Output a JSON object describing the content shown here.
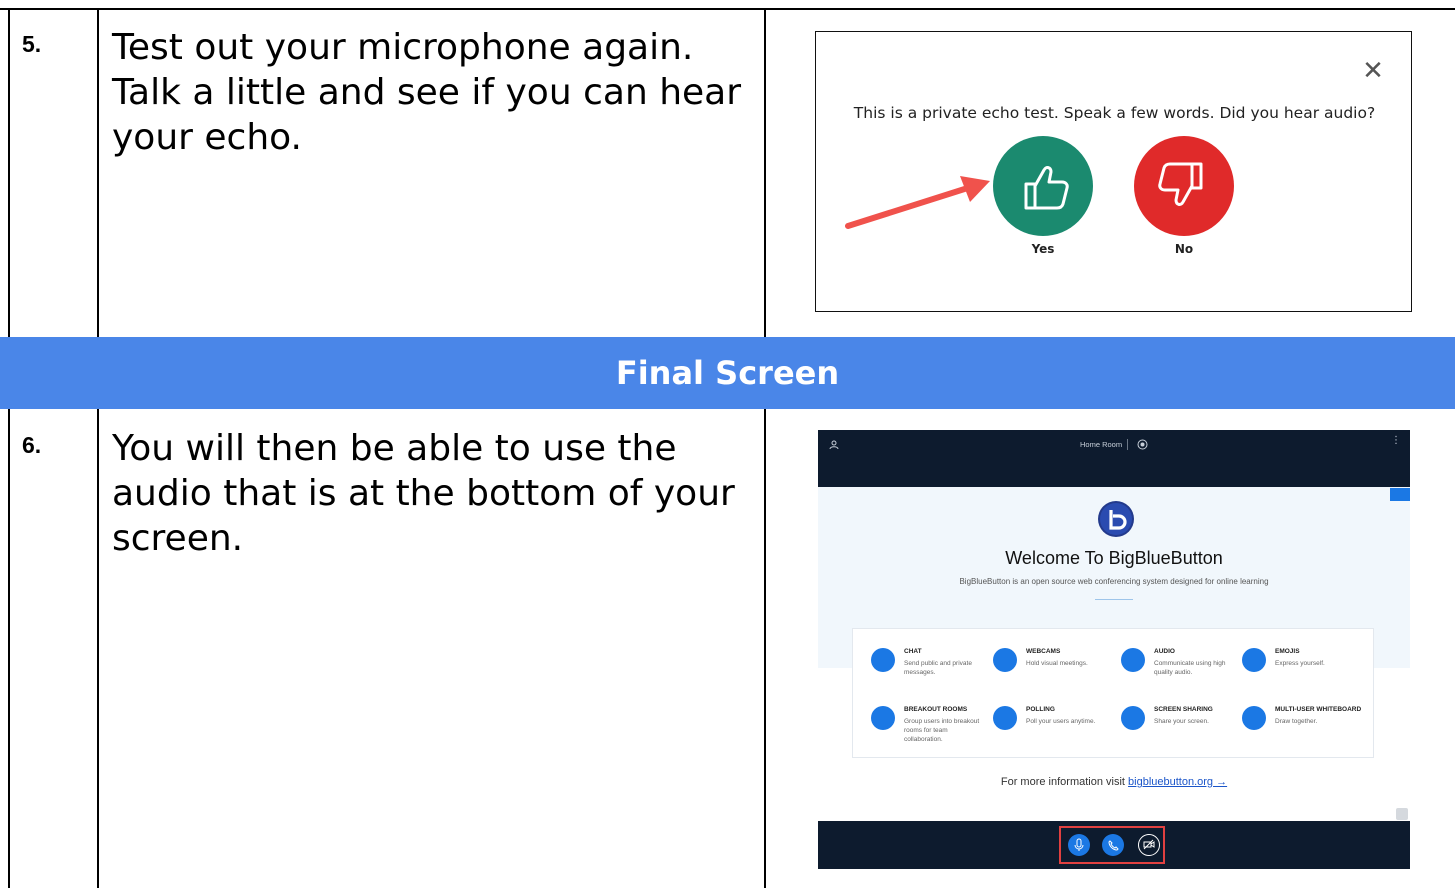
{
  "rows": [
    {
      "number": "5.",
      "lines": [
        "Test out your microphone again.",
        "Talk a little and see if you can hear",
        "your echo."
      ]
    },
    {
      "number": "6.",
      "lines": [
        "You will then be able to use the",
        "audio that is at the bottom of your",
        "screen."
      ]
    }
  ],
  "section_header": "Final Screen",
  "echo_dialog": {
    "close_glyph": "✕",
    "question": "This is a private echo test. Speak a few words. Did you hear audio?",
    "yes_label": "Yes",
    "no_label": "No",
    "colors": {
      "yes": "#1b8a6f",
      "no": "#e02a2a",
      "arrow": "#f0524c"
    }
  },
  "bbb": {
    "room_name": "Home Room",
    "welcome_title": "Welcome To BigBlueButton",
    "welcome_subtitle": "BigBlueButton is an open source web conferencing system designed for online learning",
    "features": [
      {
        "title": "CHAT",
        "desc": "Send public and private messages."
      },
      {
        "title": "WEBCAMS",
        "desc": "Hold visual meetings."
      },
      {
        "title": "AUDIO",
        "desc": "Communicate using high quality audio."
      },
      {
        "title": "EMOJIS",
        "desc": "Express yourself."
      },
      {
        "title": "BREAKOUT ROOMS",
        "desc": "Group users into breakout rooms for team collaboration."
      },
      {
        "title": "POLLING",
        "desc": "Poll your users anytime."
      },
      {
        "title": "SCREEN SHARING",
        "desc": "Share your screen."
      },
      {
        "title": "MULTI-USER WHITEBOARD",
        "desc": "Draw together."
      }
    ],
    "more_info_prefix": "For more information visit",
    "more_info_link": "bigbluebutton.org →",
    "colors": {
      "dark": "#0d1b2e",
      "accent": "#1b78e4",
      "highlight": "#e04040"
    }
  }
}
